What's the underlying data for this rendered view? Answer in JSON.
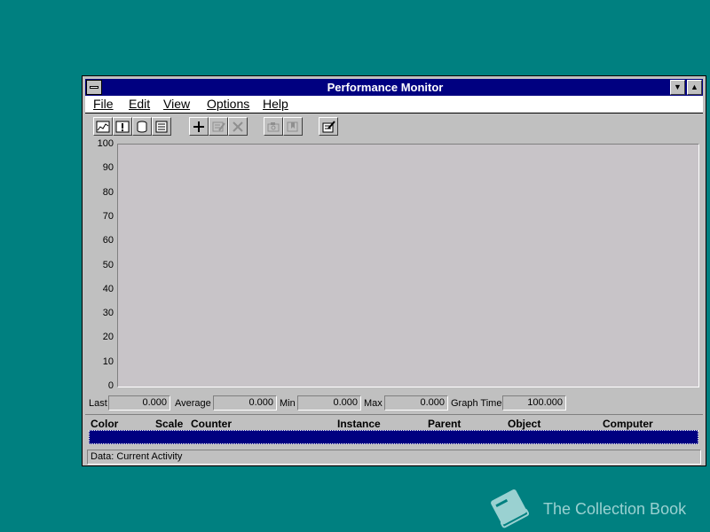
{
  "window": {
    "title": "Performance Monitor"
  },
  "menu": [
    "File",
    "Edit",
    "View",
    "Options",
    "Help"
  ],
  "toolbar": {
    "buttons": [
      {
        "name": "chart-view-icon"
      },
      {
        "name": "alert-view-icon"
      },
      {
        "name": "log-view-icon"
      },
      {
        "name": "report-view-icon"
      },
      {
        "name": "add-counter-icon"
      },
      {
        "name": "edit-counter-icon"
      },
      {
        "name": "delete-counter-icon"
      },
      {
        "name": "update-now-icon"
      },
      {
        "name": "bookmark-icon"
      },
      {
        "name": "options-icon"
      }
    ]
  },
  "chart": {
    "y_ticks": [
      "100",
      "90",
      "80",
      "70",
      "60",
      "50",
      "40",
      "30",
      "20",
      "10",
      "0"
    ]
  },
  "stats": {
    "last_label": "Last",
    "last_value": "0.000",
    "average_label": "Average",
    "average_value": "0.000",
    "min_label": "Min",
    "min_value": "0.000",
    "max_label": "Max",
    "max_value": "0.000",
    "graph_time_label": "Graph Time",
    "graph_time_value": "100.000"
  },
  "legend": {
    "columns": [
      "Color",
      "Scale",
      "Counter",
      "Instance",
      "Parent",
      "Object",
      "Computer"
    ]
  },
  "status": {
    "text": "Data: Current Activity"
  },
  "watermark": {
    "text": "The Collection Book"
  },
  "colors": {
    "desktop": "#008080",
    "titlebar": "#000080",
    "face": "#c0c0c0",
    "selection": "#000080"
  }
}
